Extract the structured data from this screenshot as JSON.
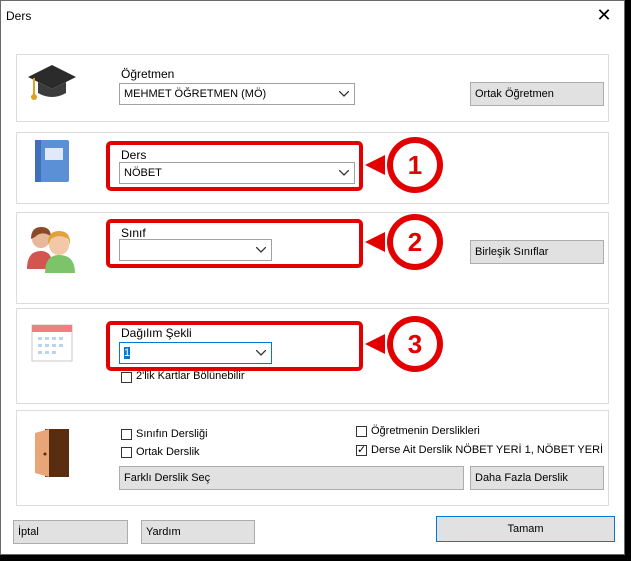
{
  "window": {
    "title": "Ders",
    "close_glyph": "✕"
  },
  "teacher": {
    "label": "Öğretmen",
    "value": "MEHMET ÖĞRETMEN (MÖ)",
    "button": "Ortak Öğretmen",
    "icon": "graduation-cap-icon"
  },
  "course": {
    "label": "Ders",
    "value": "NÖBET",
    "icon": "book-icon"
  },
  "class": {
    "label": "Sınıf",
    "value": "",
    "button": "Birleşik Sınıflar",
    "icon": "students-icon"
  },
  "distribution": {
    "label": "Dağılım Şekli",
    "value": "1",
    "split_label": "2'lik Kartlar Bölünebilir",
    "split_checked": false,
    "icon": "calendar-icon"
  },
  "rooms": {
    "icon": "door-icon",
    "class_room": {
      "label": "Sınıfın Dersliği",
      "checked": false
    },
    "shared_room": {
      "label": "Ortak Derslik",
      "checked": false
    },
    "teacher_rooms": {
      "label": "Öğretmenin Derslikleri",
      "checked": false
    },
    "course_rooms": {
      "label": "Derse Ait Derslik NÖBET YERİ 1, NÖBET YERİ",
      "checked": true
    },
    "choose_other_button": "Farklı Derslik Seç",
    "more_rooms_button": "Daha Fazla Derslik"
  },
  "footer": {
    "cancel": "İptal",
    "help": "Yardım",
    "ok": "Tamam"
  },
  "annotations": {
    "marker_1": "1",
    "marker_2": "2",
    "marker_3": "3",
    "color": "#e30000"
  }
}
